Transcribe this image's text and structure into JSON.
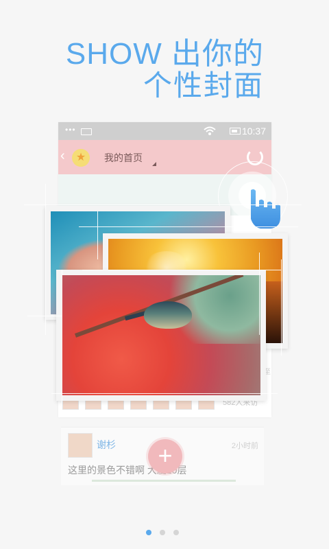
{
  "headline": {
    "line1": "SHOW 出你的",
    "line2": "个性封面"
  },
  "phone": {
    "status_time": "10:37",
    "appbar_title": "我的首页",
    "visitors_text": "582人来访",
    "side_snippet": "字至 6("
  },
  "feed": {
    "name": "谢杉",
    "time_ago": "2小时前",
    "text": "这里的景色不错啊          大厦10层"
  },
  "fab_label": "+",
  "pager": {
    "count": 3,
    "active_index": 0
  },
  "colors": {
    "accent": "#5aa9ec",
    "appbar": "#f4c9cb",
    "fab": "#f1b9bc",
    "background": "#f6f6f6"
  },
  "icons": [
    "back-chevron-icon",
    "star-logo-icon",
    "refresh-icon",
    "wifi-icon",
    "battery-icon",
    "pointing-hand-icon"
  ]
}
